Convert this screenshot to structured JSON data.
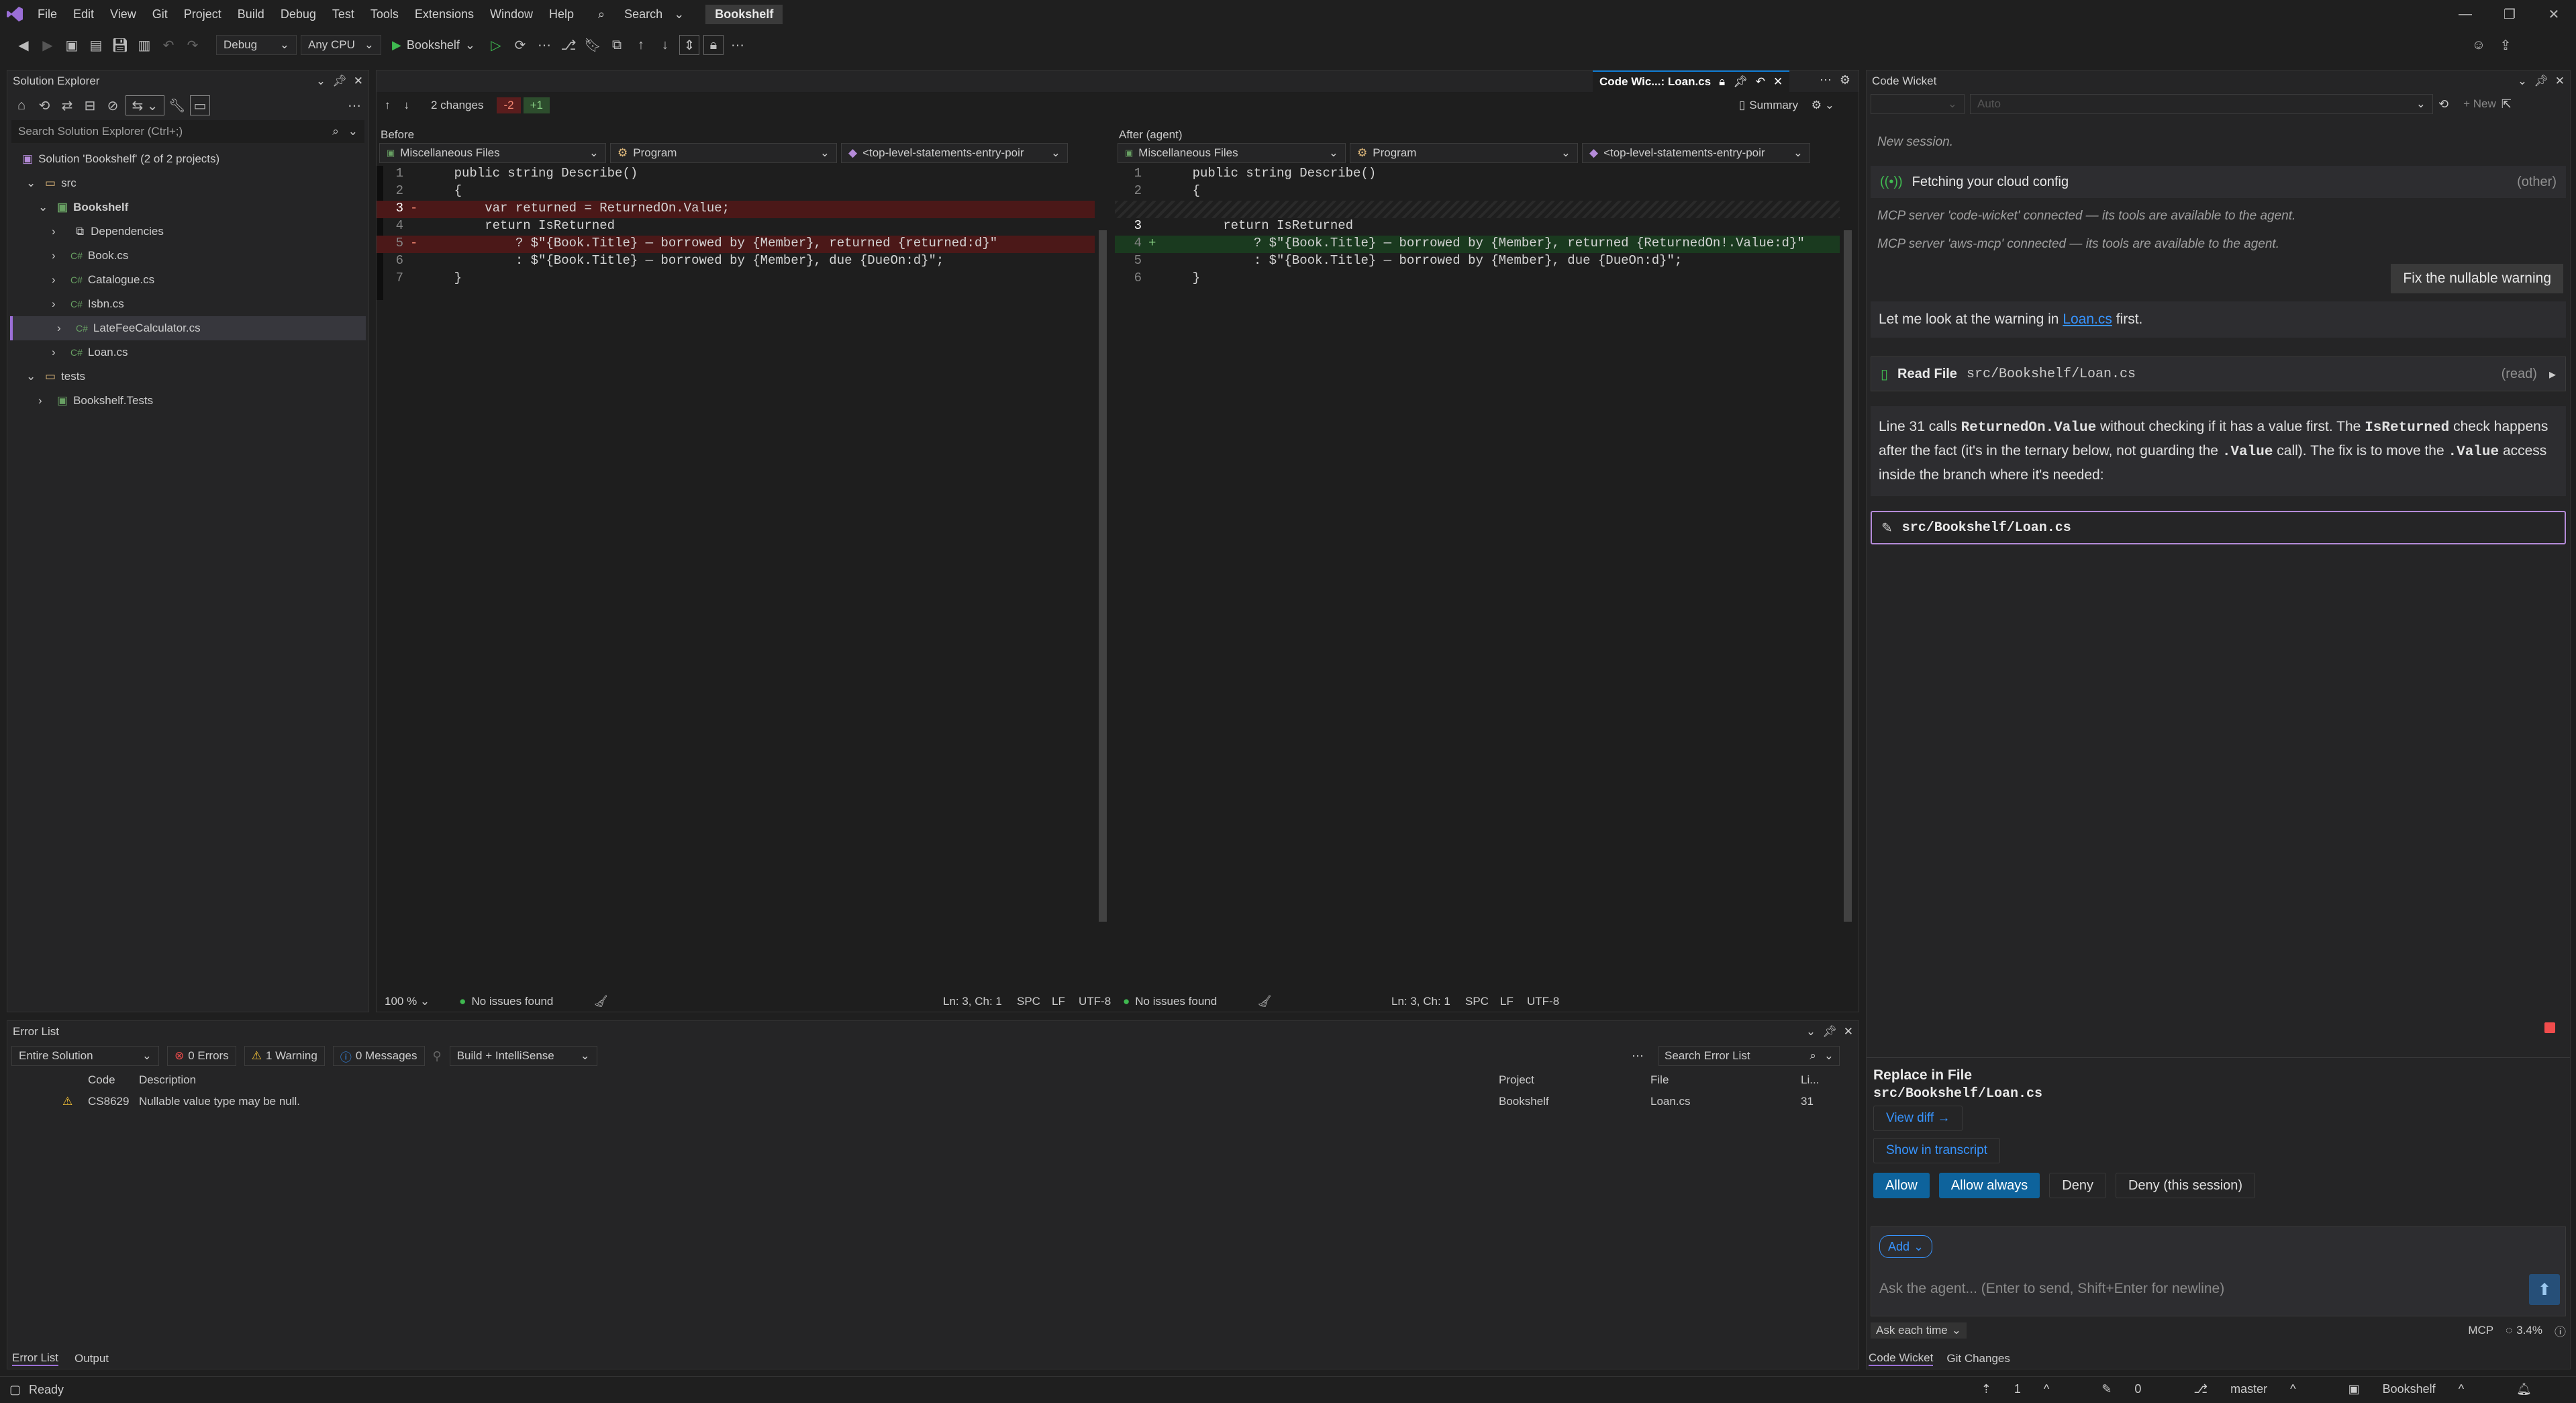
{
  "title_bar": {
    "menu": [
      "File",
      "Edit",
      "View",
      "Git",
      "Project",
      "Build",
      "Debug",
      "Test",
      "Tools",
      "Extensions",
      "Window",
      "Help"
    ],
    "search_label": "Search",
    "solution_name": "Bookshelf"
  },
  "toolbar": {
    "config": "Debug",
    "platform": "Any CPU",
    "run_target": "Bookshelf"
  },
  "solution_explorer": {
    "title": "Solution Explorer",
    "search_placeholder": "Search Solution Explorer (Ctrl+;)",
    "solution_label": "Solution 'Bookshelf' (2 of 2 projects)",
    "items": [
      {
        "label": "src",
        "kind": "folder",
        "depth": 1
      },
      {
        "label": "Bookshelf",
        "kind": "project",
        "depth": 2
      },
      {
        "label": "Dependencies",
        "kind": "deps",
        "depth": 3
      },
      {
        "label": "Book.cs",
        "kind": "cs",
        "depth": 3
      },
      {
        "label": "Catalogue.cs",
        "kind": "cs",
        "depth": 3
      },
      {
        "label": "Isbn.cs",
        "kind": "cs",
        "depth": 3
      },
      {
        "label": "LateFeeCalculator.cs",
        "kind": "cs",
        "depth": 3
      },
      {
        "label": "Loan.cs",
        "kind": "cs",
        "depth": 3
      },
      {
        "label": "tests",
        "kind": "folder",
        "depth": 1
      },
      {
        "label": "Bookshelf.Tests",
        "kind": "project",
        "depth": 2
      }
    ]
  },
  "diff": {
    "tab_title": "Code Wic...: Loan.cs",
    "changes": "2 changes",
    "removed": "-2",
    "added": "+1",
    "summary": "Summary",
    "left_label": "Before",
    "right_label": "After (agent)",
    "nav": [
      "Miscellaneous Files",
      "Program",
      "<top-level-statements-entry-poir"
    ],
    "zoom": "100 %",
    "issues": "No issues found",
    "position": "Ln: 3, Ch: 1",
    "spc": "SPC",
    "lf": "LF",
    "encoding": "UTF-8",
    "left_lines": [
      {
        "n": "1",
        "text": "    public string Describe()",
        "type": "normal"
      },
      {
        "n": "2",
        "text": "    {",
        "type": "normal"
      },
      {
        "n": "3",
        "text": "        var returned = ReturnedOn.Value;",
        "type": "del"
      },
      {
        "n": "4",
        "text": "        return IsReturned",
        "type": "normal"
      },
      {
        "n": "5",
        "text": "            ? $\"{Book.Title} — borrowed by {Member}, returned {returned:d}\"",
        "type": "del"
      },
      {
        "n": "6",
        "text": "            : $\"{Book.Title} — borrowed by {Member}, due {DueOn:d}\";",
        "type": "normal"
      },
      {
        "n": "7",
        "text": "    }",
        "type": "normal"
      }
    ],
    "right_lines": [
      {
        "n": "1",
        "text": "    public string Describe()",
        "type": "normal"
      },
      {
        "n": "2",
        "text": "    {",
        "type": "normal"
      },
      {
        "n": "",
        "text": "",
        "type": "blank"
      },
      {
        "n": "3",
        "text": "        return IsReturned",
        "type": "normal"
      },
      {
        "n": "4",
        "text": "            ? $\"{Book.Title} — borrowed by {Member}, returned {ReturnedOn!.Value:d}\"",
        "type": "add"
      },
      {
        "n": "5",
        "text": "            : $\"{Book.Title} — borrowed by {Member}, due {DueOn:d}\";",
        "type": "normal"
      },
      {
        "n": "6",
        "text": "    }",
        "type": "normal"
      }
    ]
  },
  "error_list": {
    "title": "Error List",
    "scope": "Entire Solution",
    "errors": "0 Errors",
    "warnings": "1 Warning",
    "messages": "0 Messages",
    "source": "Build + IntelliSense",
    "search_placeholder": "Search Error List",
    "columns": [
      "Code",
      "Description",
      "Project",
      "File",
      "Li..."
    ],
    "rows": [
      {
        "code": "CS8629",
        "description": "Nullable value type may be null.",
        "project": "Bookshelf",
        "file": "Loan.cs",
        "line": "31"
      }
    ],
    "tabs": [
      "Error List",
      "Output"
    ]
  },
  "chat": {
    "title": "Code Wicket",
    "new_label": "+ New",
    "model_placeholder": "Auto",
    "new_session": "New session.",
    "fetching": "Fetching your cloud config",
    "fetching_tag": "(other)",
    "mcp_1": "MCP server 'code-wicket' connected — its tools are available to the agent.",
    "mcp_2": "MCP server 'aws-mcp' connected — its tools are available to the agent.",
    "user_message": "Fix the nullable warning",
    "reply_1_prefix": "Let me look at the warning in ",
    "reply_1_link": "Loan.cs",
    "reply_1_suffix": " first.",
    "read_file_label": "Read File",
    "read_file_path": "src/Bookshelf/Loan.cs",
    "read_tag": "(read)",
    "reply_2": {
      "a": "Line 31 calls ",
      "b": "ReturnedOn.Value",
      "c": " without checking if it has a value first. The ",
      "d": "IsReturned",
      "e": " check happens after the fact (it's in the ternary below, not guarding the ",
      "f": ".Value",
      "g": " call). The fix is to move the ",
      "h": ".Value",
      "i": " access inside the branch where it's needed:"
    },
    "edit_path": "src/Bookshelf/Loan.cs",
    "permission": {
      "title": "Replace in File",
      "path": "src/Bookshelf/Loan.cs",
      "view_diff": "View diff →",
      "show_transcript": "Show in transcript",
      "allow": "Allow",
      "allow_always": "Allow always",
      "deny": "Deny",
      "deny_session": "Deny (this session)"
    },
    "add_label": "Add",
    "input_placeholder": "Ask the agent... (Enter to send, Shift+Enter for newline)",
    "mode": "Ask each time",
    "mcp_label": "MCP",
    "usage": "3.4%",
    "tabs": [
      "Code Wicket",
      "Git Changes"
    ]
  },
  "status_bar": {
    "state": "Ready",
    "up_count": "1",
    "edit_count": "0",
    "branch": "master",
    "repo": "Bookshelf"
  },
  "colors": {
    "accent": "#0e639c",
    "del_bg": "#4b1818",
    "add_bg": "#1a3a1f",
    "warning": "#f2c037",
    "link": "#3794ff"
  }
}
